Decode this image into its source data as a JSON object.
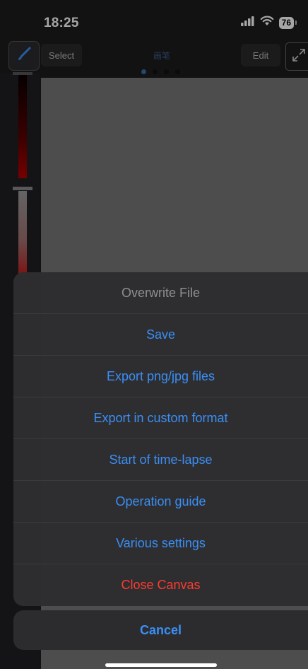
{
  "status": {
    "time": "18:25",
    "battery": "76"
  },
  "toolbar": {
    "select_label": "Select",
    "layer_name": "画笔",
    "edit_label": "Edit",
    "page_dots": 4,
    "active_page": 1
  },
  "icons": {
    "brush": "brush-icon",
    "expand": "expand-icon",
    "signal": "signal-icon",
    "wifi": "wifi-icon"
  },
  "sheet": {
    "title": "Overwrite File",
    "items": [
      {
        "label": "Save"
      },
      {
        "label": "Export png/jpg files"
      },
      {
        "label": "Export in custom format"
      },
      {
        "label": "Start of time-lapse"
      },
      {
        "label": "Operation guide"
      },
      {
        "label": "Various settings"
      },
      {
        "label": "Close Canvas",
        "destructive": true
      }
    ],
    "cancel_label": "Cancel"
  },
  "colors": {
    "accent": "#3a8ff6",
    "destructive": "#ff3b30",
    "sheet_bg": "#2e2e30"
  }
}
